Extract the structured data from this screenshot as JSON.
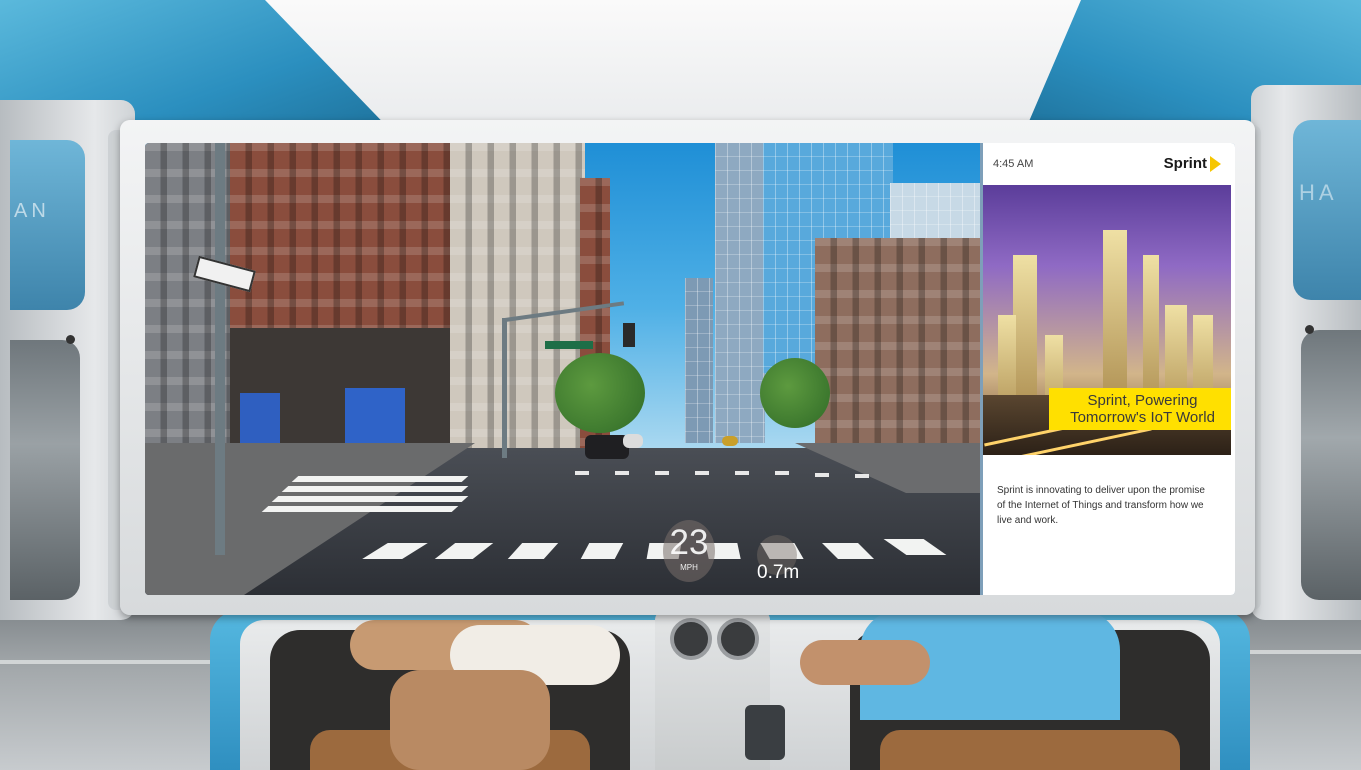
{
  "dashboard": {
    "speed": "23",
    "speed_unit": "MPH",
    "distance": "0.7m"
  },
  "ad_panel": {
    "time": "4:45 AM",
    "brand": "Sprint",
    "headline_line1": "Sprint, Powering",
    "headline_line2": "Tomorrow's IoT World",
    "body": "Sprint is innovating to deliver upon the promise of the Internet of Things and transform how we live and work.",
    "brand_color": "#ffe000"
  },
  "vehicle": {
    "left_window_text": "AN",
    "right_window_text": "HA",
    "body_color": "#2f8fc0"
  },
  "icons": {
    "brand_logo": "sprint-chevron-icon"
  }
}
